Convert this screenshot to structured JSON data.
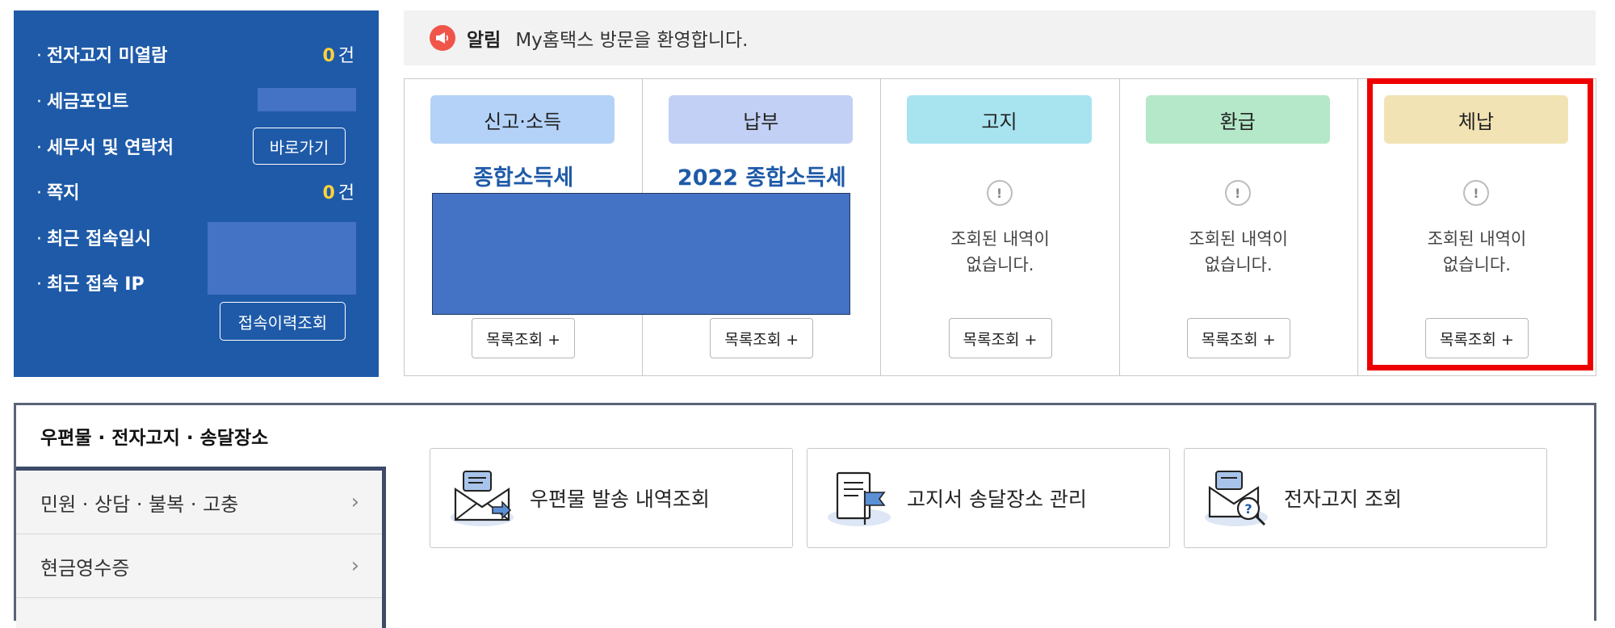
{
  "profile": {
    "rows": [
      {
        "bullet": "·",
        "label": "전자고지 미열람",
        "value": "0",
        "unit": "건"
      },
      {
        "bullet": "·",
        "label": "세금포인트"
      },
      {
        "bullet": "·",
        "label": "세무서 및 연락처",
        "button": "바로가기"
      },
      {
        "bullet": "·",
        "label": "쪽지",
        "value": "0",
        "unit": "건"
      },
      {
        "bullet": "·",
        "label": "최근 접속일시"
      },
      {
        "bullet": "·",
        "label": "최근 접속 IP"
      }
    ],
    "history_button": "접속이력조회"
  },
  "notice": {
    "icon": "megaphone-icon",
    "title": "알림",
    "text": "My홈택스 방문을 환영합니다."
  },
  "cards": [
    {
      "title": "신고·소득",
      "subtitle": "종합소득세",
      "header_color": "#b4d2f7",
      "button": "목록조회 +"
    },
    {
      "title": "납부",
      "subtitle": "2022 종합소득세",
      "header_color": "#c2d0f5",
      "button": "목록조회 +"
    },
    {
      "title": "고지",
      "empty_line1": "조회된 내역이",
      "empty_line2": "없습니다.",
      "header_color": "#a8e3f0",
      "button": "목록조회 +"
    },
    {
      "title": "환급",
      "empty_line1": "조회된 내역이",
      "empty_line2": "없습니다.",
      "header_color": "#b4e8c8",
      "button": "목록조회 +"
    },
    {
      "title": "체납",
      "empty_line1": "조회된 내역이",
      "empty_line2": "없습니다.",
      "header_color": "#f2e3b4",
      "button": "목록조회 +"
    }
  ],
  "bottom": {
    "active_tab": "우편물 · 전자고지 · 송달장소",
    "side_items": [
      {
        "label": "민원 · 상담 · 불복 · 고충",
        "chevron": "›"
      },
      {
        "label": "현금영수증",
        "chevron": "›"
      }
    ],
    "services": [
      {
        "label": "우편물 발송 내역조회",
        "icon": "mail-send-icon"
      },
      {
        "label": "고지서 송달장소 관리",
        "icon": "document-flag-icon"
      },
      {
        "label": "전자고지 조회",
        "icon": "mail-search-icon"
      }
    ]
  },
  "colors": {
    "panel_blue": "#1e5aa8",
    "highlight_red": "#ee0000",
    "count_yellow": "#ffd23a",
    "redaction_blue": "#4472c4"
  }
}
